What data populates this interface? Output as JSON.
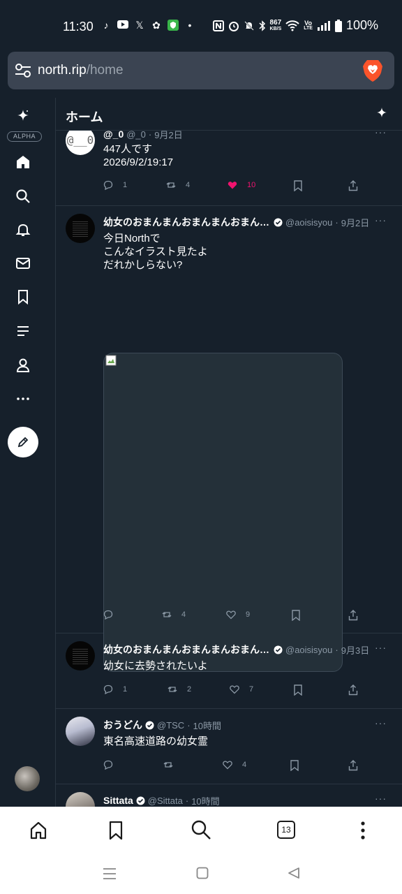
{
  "status": {
    "time": "11:30",
    "speed": "867",
    "speed_unit": "KB/S",
    "network_top": "Vo",
    "network_bottom": "LTE",
    "battery": "100%"
  },
  "browser": {
    "url_host": "north.rip",
    "url_path": "/home"
  },
  "sidebar": {
    "badge": "ALPHA",
    "items": [
      {
        "name": "home",
        "icon": "home-icon"
      },
      {
        "name": "search",
        "icon": "search-icon"
      },
      {
        "name": "notifications",
        "icon": "bell-icon"
      },
      {
        "name": "messages",
        "icon": "mail-icon"
      },
      {
        "name": "bookmarks",
        "icon": "bookmark-icon"
      },
      {
        "name": "lists",
        "icon": "list-icon"
      },
      {
        "name": "profile",
        "icon": "person-icon"
      },
      {
        "name": "more",
        "icon": "more-icon"
      }
    ]
  },
  "header": {
    "title": "ホーム"
  },
  "posts": [
    {
      "avatar_text": "@__0",
      "name": "@_0",
      "handle": "@_0",
      "date": "9月2日",
      "text": "447人です\n2026/9/2/19:17",
      "replies": "1",
      "reposts": "4",
      "likes": "10",
      "liked": true
    },
    {
      "name": "幼女のおまんまんおまんまんおまんまんおまんまん",
      "handle": "@aoisisyou",
      "date": "9月2日",
      "verified": true,
      "text": "今日Northで\nこんなイラスト見たよ\nだれかしらない?",
      "replies": "",
      "reposts": "4",
      "likes": "9"
    },
    {
      "name": "幼女のおまんまんおまんまんおまんまんおまんまん",
      "handle": "@aoisisyou",
      "date": "9月3日",
      "verified": true,
      "text": "幼女に去勢されたいよ",
      "replies": "1",
      "reposts": "2",
      "likes": "7"
    },
    {
      "name": "おうどん",
      "handle": "@TSC",
      "date": "10時間",
      "verified": true,
      "text": "東名高速道路の幼女霊",
      "replies": "",
      "reposts": "",
      "likes": "4"
    },
    {
      "name": "Sittata",
      "handle": "@Sittata",
      "date": "10時間",
      "verified": true
    }
  ],
  "bottom_bar": {
    "tab_count": "13"
  },
  "colors": {
    "background": "#16202b",
    "like": "#f0136e",
    "muted": "#8b98a5"
  }
}
